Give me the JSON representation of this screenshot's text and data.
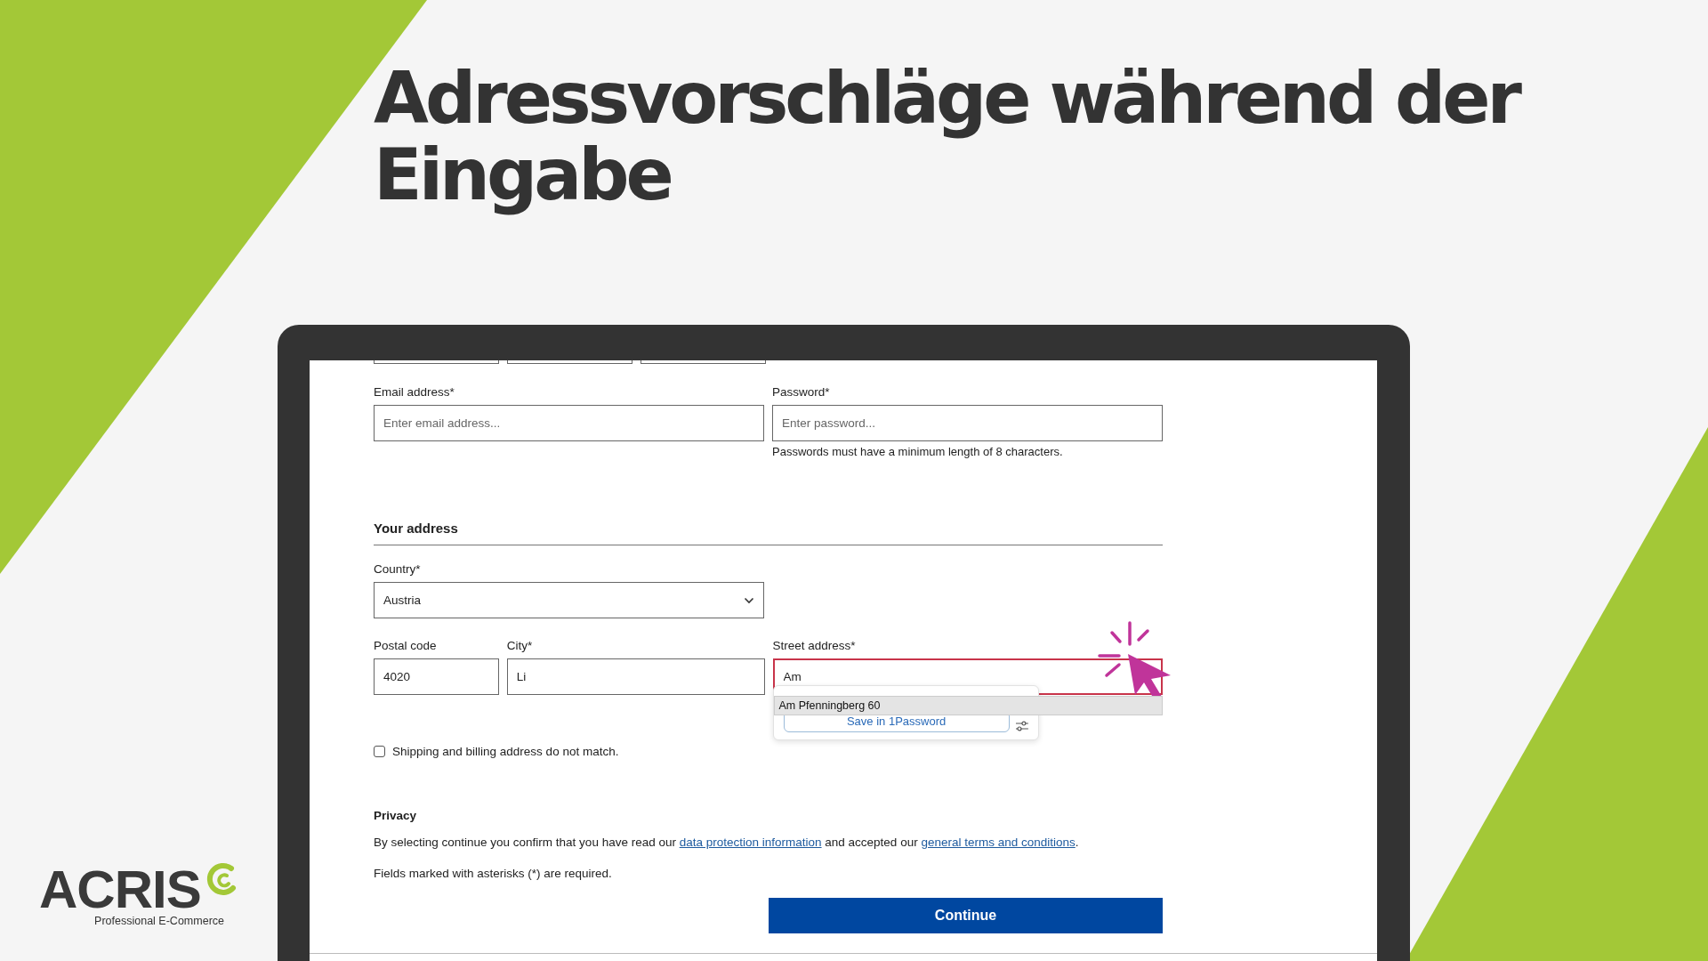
{
  "headline": "Adressvorschläge während der Eingabe",
  "form": {
    "account_fields": [
      {
        "label": "Email address*",
        "placeholder": "Enter email address..."
      },
      {
        "label": "Password*",
        "placeholder": "Enter password..."
      }
    ],
    "password_hint": "Passwords must have a minimum length of 8 characters.",
    "address_heading": "Your address",
    "country": {
      "label": "Country*",
      "value": "Austria"
    },
    "address_fields": [
      {
        "label": "Postal code",
        "value": "4020",
        "focused": false
      },
      {
        "label": "City*",
        "value": "Li",
        "focused": false
      },
      {
        "label": "Street address*",
        "value": "Am",
        "focused": true
      }
    ],
    "suggestions": [
      "Am Pfenningberg 60"
    ],
    "password_manager": {
      "button": "Save in 1Password"
    },
    "different_billing": {
      "label": "Shipping and billing address do not match.",
      "checked": false
    },
    "privacy": {
      "heading": "Privacy",
      "text_before": "By selecting continue you confirm that you have read our ",
      "link_1": "data protection information",
      "text_middle": " and accepted our ",
      "link_2": "general terms and conditions",
      "text_after": "."
    },
    "required_note": "Fields marked with asterisks (*) are required.",
    "continue_button": "Continue"
  },
  "logo": {
    "name": "ACRIS",
    "tagline": "Professional E-Commerce"
  }
}
